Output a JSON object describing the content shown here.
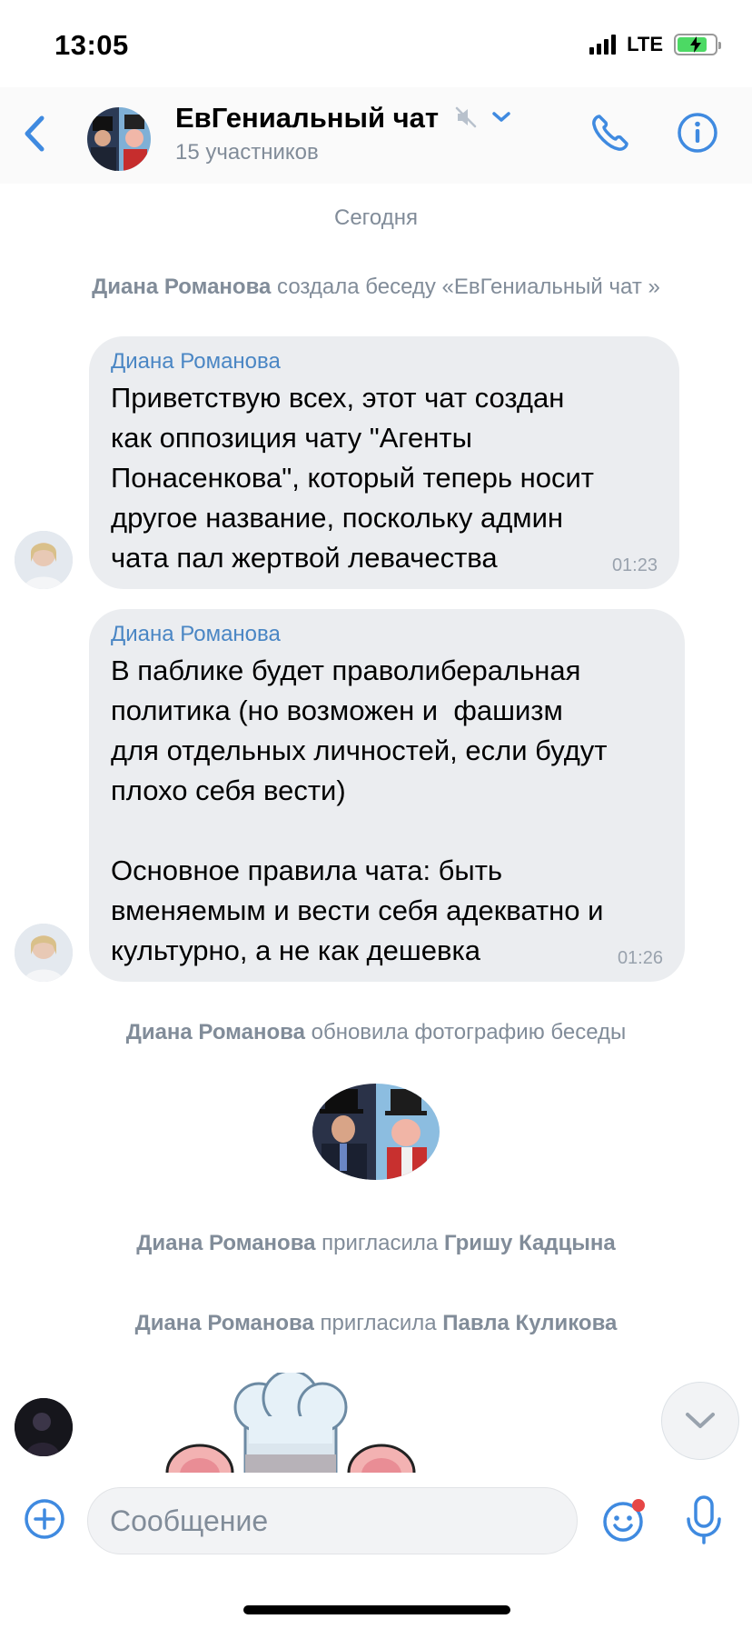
{
  "status": {
    "time": "13:05",
    "network": "LTE",
    "battery_level": 0.8
  },
  "header": {
    "title": "ЕвГениальный чат",
    "subtitle": "15 участников",
    "icons": [
      "back-icon",
      "muted-icon",
      "chevron-down-icon",
      "phone-icon",
      "info-icon"
    ]
  },
  "chat": {
    "date": "Сегодня",
    "events": [
      {
        "actor": "Диана Романова",
        "text": "создала беседу «ЕвГениальный чат »"
      },
      {
        "actor": "Диана Романова",
        "text": "обновила фотографию беседы"
      },
      {
        "actor": "Диана Романова",
        "text": "пригласила",
        "target": "Гришу Кадцына"
      },
      {
        "actor": "Диана Романова",
        "text": "пригласила",
        "target": "Павла Куликова"
      }
    ],
    "messages": [
      {
        "sender": "Диана Романова",
        "text": "Приветствую всех, этот чат создан\nкак оппозиция чату \"Агенты\nПонасенкова\", который теперь носит\nдругое название, поскольку админ\nчата пал жертвой левачества",
        "time": "01:23"
      },
      {
        "sender": "Диана Романова",
        "text": "В паблике будет праволиберальная\nполитика (но возможен и  фашизм\nдля отдельных личностей, если будут\nплохо себя вести)\n\nОсновное правила чата: быть\nвменяемым и вести себя адекватно и\nкультурно, а не как дешевка",
        "time": "01:26"
      }
    ]
  },
  "composer": {
    "placeholder": "Сообщение"
  },
  "colors": {
    "accent": "#3f8ae0",
    "bubble": "#ebedf0",
    "secondary_text": "#818c99",
    "sender_name": "#4a86c4"
  }
}
